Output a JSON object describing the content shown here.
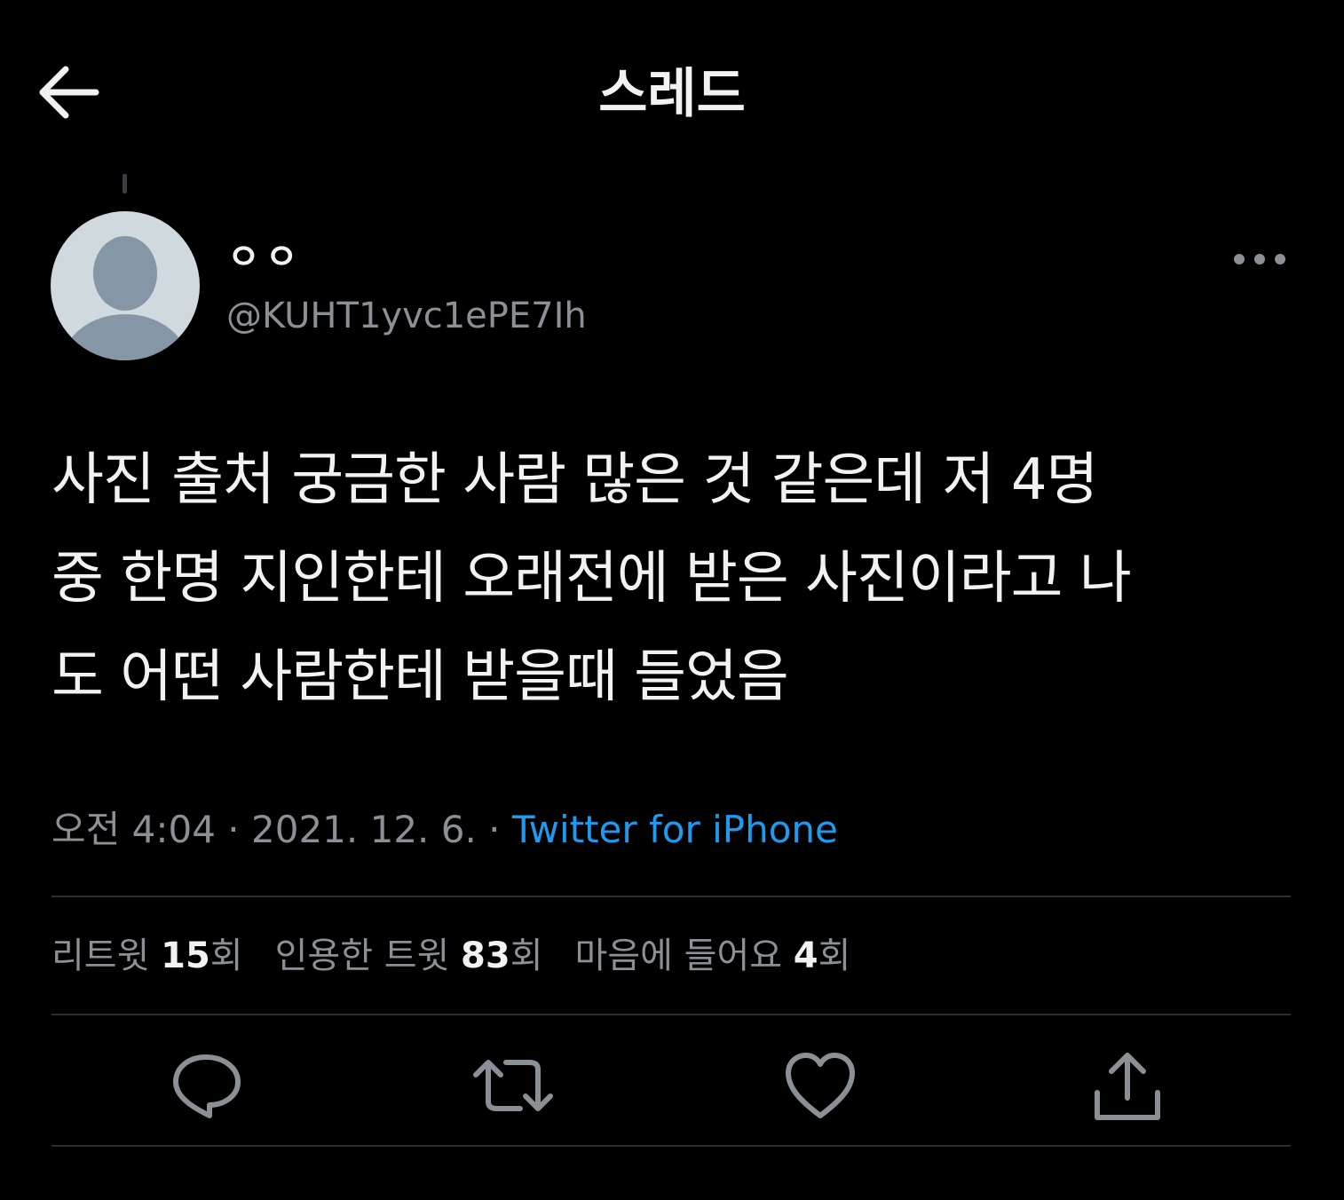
{
  "header": {
    "title": "스레드",
    "back_icon": "arrow-left-icon"
  },
  "tweet": {
    "author": {
      "display_name": "ㅇㅇ",
      "handle": "@KUHT1yvc1ePE7Ih"
    },
    "text": "사진 출처 궁금한 사람 많은 것 같은데 저 4명\n중 한명 지인한테 오래전에 받은 사진이라고 나\n도 어떤 사람한테 받을때 들었음",
    "time": "오전 4:04",
    "date": "2021. 12. 6.",
    "separator": " · ",
    "source": "Twitter for iPhone"
  },
  "stats": {
    "retweets_label": "리트윗",
    "retweets_count": "15",
    "retweets_unit": "회",
    "quotes_label": "인용한 트윗",
    "quotes_count": "83",
    "quotes_unit": "회",
    "likes_label": "마음에 들어요",
    "likes_count": "4",
    "likes_unit": "회"
  },
  "actions": {
    "reply_icon": "reply-icon",
    "retweet_icon": "retweet-icon",
    "like_icon": "heart-icon",
    "share_icon": "share-icon"
  },
  "colors": {
    "background": "#000000",
    "text_primary": "#f2f2f2",
    "text_secondary": "#8b9096",
    "link": "#1d9bf0",
    "divider": "#2a2d31",
    "avatar_bg": "#cfd9de",
    "avatar_fg": "#8597a7"
  }
}
